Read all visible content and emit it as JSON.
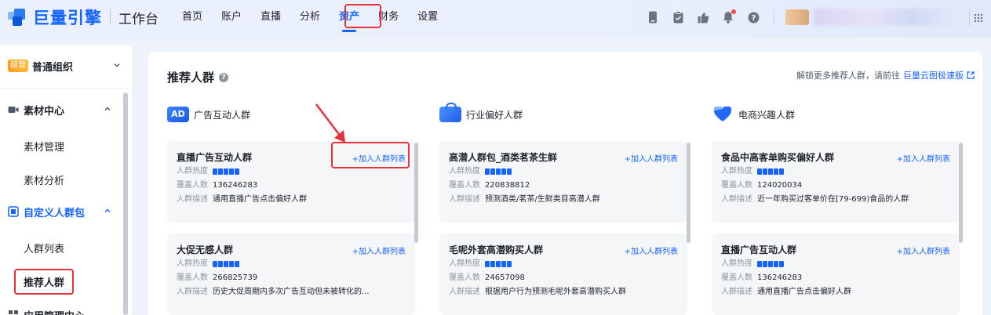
{
  "header": {
    "brand": "巨量引擎",
    "workspace": "工作台",
    "nav": [
      {
        "label": "首页"
      },
      {
        "label": "账户"
      },
      {
        "label": "直播"
      },
      {
        "label": "分析"
      },
      {
        "label": "资产",
        "active": true
      },
      {
        "label": "财务"
      },
      {
        "label": "设置"
      }
    ],
    "tools": [
      "phone-icon",
      "clipboard-icon",
      "thumb-icon",
      "bell-icon",
      "help-icon"
    ],
    "accent_color": "#1664ff"
  },
  "sidebar": {
    "org_tag": "超管",
    "org_name": "普通组织",
    "groups": [
      {
        "label": "素材中心",
        "items": [
          "素材管理",
          "素材分析"
        ]
      },
      {
        "label": "自定义人群包",
        "items": [
          "人群列表",
          "推荐人群"
        ],
        "active_item": "推荐人群"
      },
      {
        "label": "应用管理中心"
      }
    ]
  },
  "main": {
    "title": "推荐人群",
    "unlock_text": "解锁更多推荐人群，请前往",
    "unlock_link": "巨量云图极速版",
    "columns": [
      {
        "title": "广告互动人群",
        "badge": "AD",
        "cards": [
          {
            "name": "直播广告互动人群",
            "add": "+加入人群列表",
            "heat_label": "人群热度",
            "cover_label": "覆盖人数",
            "cover": "136246283",
            "desc_label": "人群描述",
            "desc": "通用直播广告点击偏好人群"
          },
          {
            "name": "大促无感人群",
            "add": "+加入人群列表",
            "heat_label": "人群热度",
            "cover_label": "覆盖人数",
            "cover": "266825739",
            "desc_label": "人群描述",
            "desc": "历史大促周期内多次广告互动但未被转化的..."
          }
        ]
      },
      {
        "title": "行业偏好人群",
        "cards": [
          {
            "name": "高潜人群包_酒类茗茶生鲜",
            "add": "+加入人群列表",
            "heat_label": "人群热度",
            "cover_label": "覆盖人数",
            "cover": "220838812",
            "desc_label": "人群描述",
            "desc": "预测酒类/茗茶/生鲜类目高潜人群"
          },
          {
            "name": "毛呢外套高潜购买人群",
            "add": "+加入人群列表",
            "heat_label": "人群热度",
            "cover_label": "覆盖人数",
            "cover": "24657098",
            "desc_label": "人群描述",
            "desc": "根据用户行为预测毛呢外套高潜购买人群"
          }
        ]
      },
      {
        "title": "电商兴趣人群",
        "cards": [
          {
            "name": "食品中高客单购买偏好人群",
            "add": "+加入人群列表",
            "heat_label": "人群热度",
            "cover_label": "覆盖人数",
            "cover": "124020034",
            "desc_label": "人群描述",
            "desc": "近一年购买过客单价在[79-699)食品的人群"
          },
          {
            "name": "直播广告互动人群",
            "add": "+加入人群列表",
            "heat_label": "人群热度",
            "cover_label": "覆盖人数",
            "cover": "136246283",
            "desc_label": "人群描述",
            "desc": "通用直播广告点击偏好人群"
          }
        ]
      }
    ]
  }
}
